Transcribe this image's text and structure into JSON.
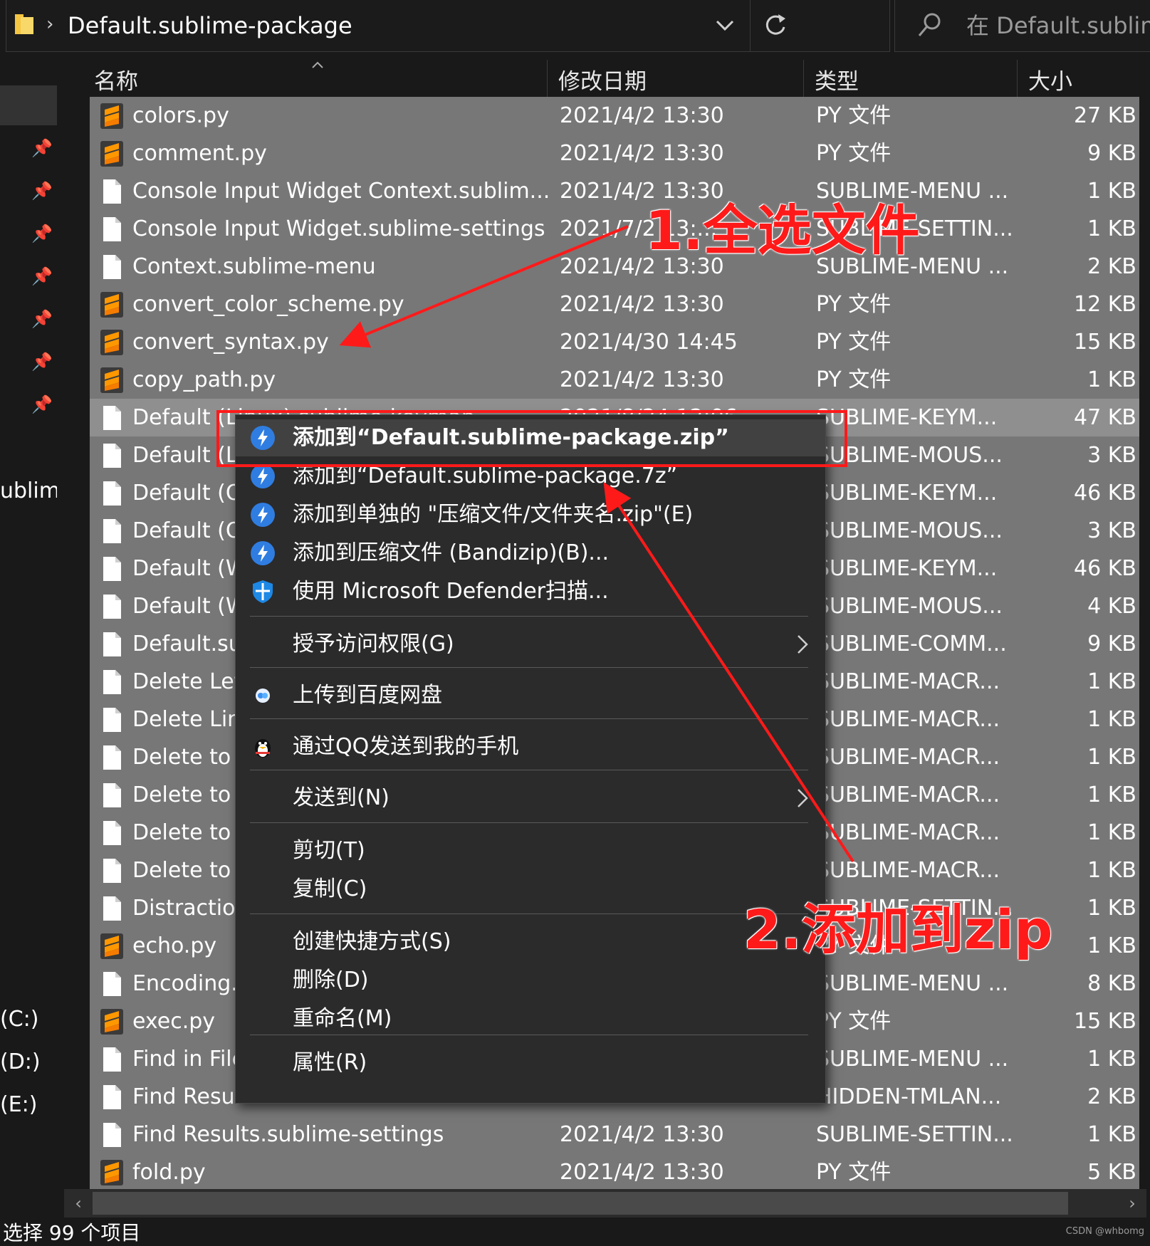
{
  "addressbar": {
    "path": "Default.sublime-package",
    "search_placeholder": "在 Default.sublim..."
  },
  "nav": {
    "partial_label": "ublim",
    "drives": [
      "(C:)",
      "(D:)",
      "(E:)"
    ]
  },
  "columns": {
    "name": "名称",
    "date": "修改日期",
    "type": "类型",
    "size": "大小"
  },
  "files": [
    {
      "name": "colors.py",
      "date": "2021/4/2 13:30",
      "type": "PY 文件",
      "size": "27 KB",
      "icon": "sublime-py-icon"
    },
    {
      "name": "comment.py",
      "date": "2021/4/2 13:30",
      "type": "PY 文件",
      "size": "9 KB",
      "icon": "sublime-py-icon"
    },
    {
      "name": "Console Input Widget Context.sublim...",
      "date": "2021/4/2 13:30",
      "type": "SUBLIME-MENU ...",
      "size": "1 KB",
      "icon": "file-icon"
    },
    {
      "name": "Console Input Widget.sublime-settings",
      "date": "2021/7/2 13:...",
      "type": "SUBLIME-SETTIN...",
      "size": "1 KB",
      "icon": "file-icon"
    },
    {
      "name": "Context.sublime-menu",
      "date": "2021/4/2 13:30",
      "type": "SUBLIME-MENU ...",
      "size": "2 KB",
      "icon": "file-icon"
    },
    {
      "name": "convert_color_scheme.py",
      "date": "2021/4/2 13:30",
      "type": "PY 文件",
      "size": "12 KB",
      "icon": "sublime-py-icon"
    },
    {
      "name": "convert_syntax.py",
      "date": "2021/4/30 14:45",
      "type": "PY 文件",
      "size": "15 KB",
      "icon": "sublime-py-icon"
    },
    {
      "name": "copy_path.py",
      "date": "2021/4/2 13:30",
      "type": "PY 文件",
      "size": "1 KB",
      "icon": "sublime-py-icon"
    },
    {
      "name": "Default (Linux).sublime-keymap",
      "date": "2021/8/24 12:06",
      "type": "SUBLIME-KEYM...",
      "size": "47 KB",
      "icon": "file-icon"
    },
    {
      "name": "Default (Li",
      "date": "",
      "type": "SUBLIME-MOUS...",
      "size": "3 KB",
      "icon": "file-icon"
    },
    {
      "name": "Default (O",
      "date": "",
      "type": "SUBLIME-KEYM...",
      "size": "46 KB",
      "icon": "file-icon"
    },
    {
      "name": "Default (O",
      "date": "",
      "type": "SUBLIME-MOUS...",
      "size": "3 KB",
      "icon": "file-icon"
    },
    {
      "name": "Default (W",
      "date": "",
      "type": "SUBLIME-KEYM...",
      "size": "46 KB",
      "icon": "file-icon"
    },
    {
      "name": "Default (W",
      "date": "",
      "type": "SUBLIME-MOUS...",
      "size": "4 KB",
      "icon": "file-icon"
    },
    {
      "name": "Default.su",
      "date": "",
      "type": "SUBLIME-COMM...",
      "size": "9 KB",
      "icon": "file-icon"
    },
    {
      "name": "Delete Lef",
      "date": "",
      "type": "SUBLIME-MACR...",
      "size": "1 KB",
      "icon": "file-icon"
    },
    {
      "name": "Delete Lin",
      "date": "",
      "type": "SUBLIME-MACR...",
      "size": "1 KB",
      "icon": "file-icon"
    },
    {
      "name": "Delete to",
      "date": "",
      "type": "SUBLIME-MACR...",
      "size": "1 KB",
      "icon": "file-icon"
    },
    {
      "name": "Delete to",
      "date": "",
      "type": "SUBLIME-MACR...",
      "size": "1 KB",
      "icon": "file-icon"
    },
    {
      "name": "Delete to",
      "date": "",
      "type": "SUBLIME-MACR...",
      "size": "1 KB",
      "icon": "file-icon"
    },
    {
      "name": "Delete to",
      "date": "",
      "type": "SUBLIME-MACR...",
      "size": "1 KB",
      "icon": "file-icon"
    },
    {
      "name": "Distraction",
      "date": "",
      "type": "SUBLIME-SETTIN...",
      "size": "1 KB",
      "icon": "file-icon"
    },
    {
      "name": "echo.py",
      "date": "",
      "type": "PY 文件",
      "size": "1 KB",
      "icon": "sublime-py-icon"
    },
    {
      "name": "Encoding.s",
      "date": "",
      "type": "SUBLIME-MENU ...",
      "size": "8 KB",
      "icon": "file-icon"
    },
    {
      "name": "exec.py",
      "date": "",
      "type": "PY 文件",
      "size": "15 KB",
      "icon": "sublime-py-icon"
    },
    {
      "name": "Find in File",
      "date": "",
      "type": "SUBLIME-MENU ...",
      "size": "1 KB",
      "icon": "file-icon"
    },
    {
      "name": "Find Resul",
      "date": "",
      "type": "HIDDEN-TMLAN...",
      "size": "2 KB",
      "icon": "file-icon"
    },
    {
      "name": "Find Results.sublime-settings",
      "date": "2021/4/2 13:30",
      "type": "SUBLIME-SETTIN...",
      "size": "1 KB",
      "icon": "file-icon"
    },
    {
      "name": "fold.py",
      "date": "2021/4/2 13:30",
      "type": "PY 文件",
      "size": "5 KB",
      "icon": "sublime-py-icon"
    }
  ],
  "context_menu": {
    "items": [
      {
        "label": "添加到“Default.sublime-package.zip”",
        "icon": "bandizip-icon",
        "bold": true,
        "hover": true
      },
      {
        "label": "添加到“Default.sublime-package.7z”",
        "icon": "bandizip-icon"
      },
      {
        "label": "添加到单独的 \"压缩文件/文件夹名.zip\"(E)",
        "icon": "bandizip-icon"
      },
      {
        "label": "添加到压缩文件 (Bandizip)(B)...",
        "icon": "bandizip-icon"
      },
      {
        "label": "使用 Microsoft Defender扫描...",
        "icon": "defender-shield-icon"
      },
      {
        "label": "授予访问权限(G)",
        "submenu": true
      },
      {
        "label": "上传到百度网盘",
        "icon": "baidu-netdisk-icon"
      },
      {
        "label": "通过QQ发送到我的手机",
        "icon": "qq-penguin-icon"
      },
      {
        "label": "发送到(N)",
        "submenu": true
      },
      {
        "label": "剪切(T)"
      },
      {
        "label": "复制(C)"
      },
      {
        "label": "创建快捷方式(S)"
      },
      {
        "label": "删除(D)"
      },
      {
        "label": "重命名(M)"
      },
      {
        "label": "属性(R)"
      }
    ]
  },
  "annotations": {
    "step1": "1.全选文件",
    "step2": "2.添加到zip"
  },
  "status": {
    "selection": "选择 99 个项目"
  },
  "watermark": "CSDN @whbomg",
  "colors": {
    "row_selected": "#777777",
    "menu_bg": "#2b2b2b",
    "annotation": "#ff1a1a",
    "bandizip": "#2f7de1"
  }
}
